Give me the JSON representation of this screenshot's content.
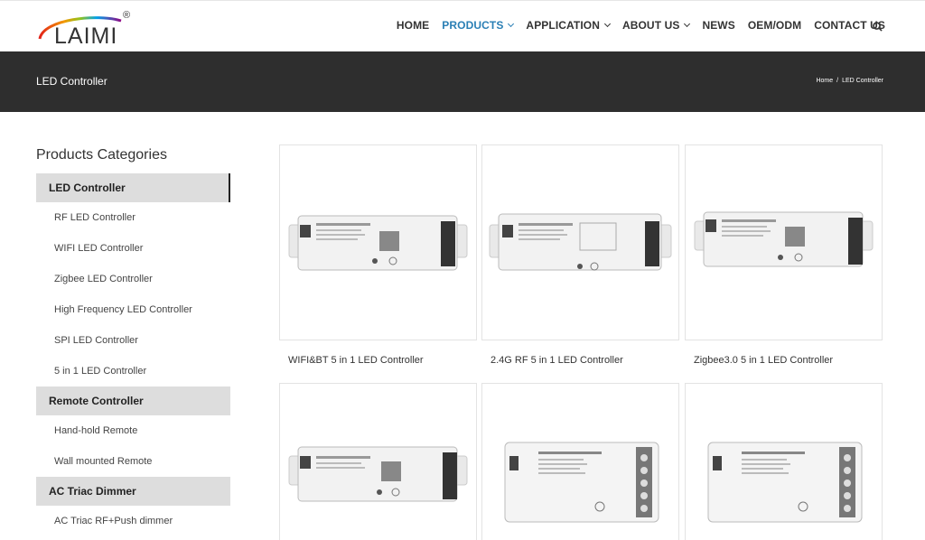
{
  "brand": {
    "name": "LAIMI",
    "reg": "®"
  },
  "nav": {
    "items": [
      {
        "label": "HOME",
        "has_menu": false,
        "active": false
      },
      {
        "label": "PRODUCTS",
        "has_menu": true,
        "active": true
      },
      {
        "label": "APPLICATION",
        "has_menu": true,
        "active": false
      },
      {
        "label": "ABOUT US",
        "has_menu": true,
        "active": false
      },
      {
        "label": "NEWS",
        "has_menu": false,
        "active": false
      },
      {
        "label": "OEM/ODM",
        "has_menu": false,
        "active": false
      },
      {
        "label": "CONTACT US",
        "has_menu": false,
        "active": false
      }
    ],
    "search_icon": "search-icon",
    "accent": "#2a7fb5"
  },
  "banner": {
    "title": "LED Controller",
    "breadcrumb": {
      "home": "Home",
      "sep": "/",
      "current": "LED Controller"
    },
    "bg": "#2e2e2e"
  },
  "sidebar": {
    "title": "Products Categories",
    "cat1": {
      "label": "LED Controller"
    },
    "cat1_items": [
      "RF LED Controller",
      "WIFI LED Controller",
      "Zigbee LED Controller",
      "High Frequency LED Controller",
      "SPI LED Controller",
      "5 in 1 LED Controller"
    ],
    "cat2": {
      "label": "Remote Controller"
    },
    "cat2_items": [
      "Hand-hold Remote",
      "Wall mounted Remote"
    ],
    "cat3": {
      "label": "AC Triac Dimmer"
    },
    "cat3_items": [
      "AC Triac RF+Push dimmer"
    ]
  },
  "products": [
    {
      "name": "WIFI&BT 5 in 1 LED Controller"
    },
    {
      "name": "2.4G RF 5 in 1 LED Controller"
    },
    {
      "name": "Zigbee3.0 5 in 1 LED Controller"
    },
    {
      "name": ""
    },
    {
      "name": ""
    },
    {
      "name": ""
    }
  ]
}
